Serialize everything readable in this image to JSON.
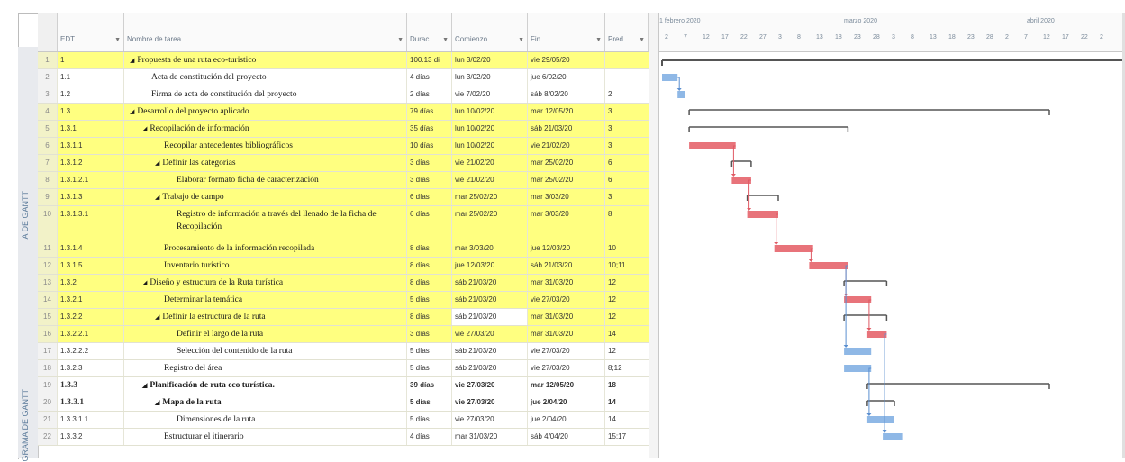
{
  "side_labels": [
    "A DE GANTT",
    "GRAMA DE GANTT"
  ],
  "columns": {
    "edt": "EDT",
    "name": "Nombre de tarea",
    "duration": "Durac",
    "start": "Comienzo",
    "end": "Fin",
    "pred": "Pred"
  },
  "timescale": {
    "months": [
      "1 febrero 2020",
      "marzo 2020",
      "abril 2020"
    ],
    "days": [
      "2",
      "7",
      "12",
      "17",
      "22",
      "27",
      "3",
      "8",
      "13",
      "18",
      "23",
      "28",
      "3",
      "8",
      "13",
      "18",
      "23",
      "28",
      "2",
      "7",
      "12",
      "17",
      "22",
      "2"
    ]
  },
  "rows": [
    {
      "num": "1",
      "edt": "1",
      "name": "Propuesta de una ruta eco-turistico",
      "indent": 0,
      "collapse": true,
      "yellow": true,
      "bold": false,
      "duration": "100.13 di",
      "start": "lun 3/02/20",
      "end": "vie 29/05/20",
      "pred": ""
    },
    {
      "num": "2",
      "edt": "1.1",
      "name": "Acta de constitución del proyecto",
      "indent": 1,
      "collapse": false,
      "yellow": false,
      "bold": false,
      "duration": "4 días",
      "start": "lun 3/02/20",
      "end": "jue 6/02/20",
      "pred": ""
    },
    {
      "num": "3",
      "edt": "1.2",
      "name": "Firma de acta de constitución del proyecto",
      "indent": 1,
      "collapse": false,
      "yellow": false,
      "bold": false,
      "duration": "2 días",
      "start": "vie 7/02/20",
      "end": "sáb 8/02/20",
      "pred": "2"
    },
    {
      "num": "4",
      "edt": "1.3",
      "name": "Desarrollo del proyecto aplicado",
      "indent": 0,
      "collapse": true,
      "yellow": true,
      "bold": false,
      "duration": "79 días",
      "start": "lun 10/02/20",
      "end": "mar 12/05/20",
      "pred": "3"
    },
    {
      "num": "5",
      "edt": "1.3.1",
      "name": "Recopilación de información",
      "indent": 1,
      "collapse": true,
      "yellow": true,
      "bold": false,
      "duration": "35 días",
      "start": "lun 10/02/20",
      "end": "sáb 21/03/20",
      "pred": "3"
    },
    {
      "num": "6",
      "edt": "1.3.1.1",
      "name": "Recopilar antecedentes bibliográficos",
      "indent": 2,
      "collapse": false,
      "yellow": true,
      "bold": false,
      "duration": "10 días",
      "start": "lun 10/02/20",
      "end": "vie 21/02/20",
      "pred": "3"
    },
    {
      "num": "7",
      "edt": "1.3.1.2",
      "name": "Definir las categorías",
      "indent": 2,
      "collapse": true,
      "yellow": true,
      "bold": false,
      "duration": "3 días",
      "start": "vie 21/02/20",
      "end": "mar 25/02/20",
      "pred": "6"
    },
    {
      "num": "8",
      "edt": "1.3.1.2.1",
      "name": "Elaborar formato ficha de caracterización",
      "indent": 3,
      "collapse": false,
      "yellow": true,
      "bold": false,
      "duration": "3 días",
      "start": "vie 21/02/20",
      "end": "mar 25/02/20",
      "pred": "6"
    },
    {
      "num": "9",
      "edt": "1.3.1.3",
      "name": "Trabajo de campo",
      "indent": 2,
      "collapse": true,
      "yellow": true,
      "bold": false,
      "duration": "6 días",
      "start": "mar 25/02/20",
      "end": "mar 3/03/20",
      "pred": "3"
    },
    {
      "num": "10",
      "edt": "1.3.1.3.1",
      "name": "Registro de información a través del llenado de la ficha de Recopilación",
      "indent": 3,
      "collapse": false,
      "yellow": true,
      "bold": false,
      "duration": "6 días",
      "start": "mar 25/02/20",
      "end": "mar 3/03/20",
      "pred": "8",
      "tall": true
    },
    {
      "num": "11",
      "edt": "1.3.1.4",
      "name": "Procesamiento de la información recopilada",
      "indent": 2,
      "collapse": false,
      "yellow": true,
      "bold": false,
      "duration": "8 días",
      "start": "mar 3/03/20",
      "end": "jue 12/03/20",
      "pred": "10"
    },
    {
      "num": "12",
      "edt": "1.3.1.5",
      "name": "Inventario turístico",
      "indent": 2,
      "collapse": false,
      "yellow": true,
      "bold": false,
      "duration": "8 días",
      "start": "jue 12/03/20",
      "end": "sáb 21/03/20",
      "pred": "10;11"
    },
    {
      "num": "13",
      "edt": "1.3.2",
      "name": "Diseño y estructura de la Ruta turística",
      "indent": 1,
      "collapse": true,
      "yellow": true,
      "bold": false,
      "duration": "8 días",
      "start": "sáb 21/03/20",
      "end": "mar 31/03/20",
      "pred": "12"
    },
    {
      "num": "14",
      "edt": "1.3.2.1",
      "name": "Determinar la temática",
      "indent": 2,
      "collapse": false,
      "yellow": true,
      "bold": false,
      "sans": true,
      "duration": "5 días",
      "start": "sáb 21/03/20",
      "end": "vie 27/03/20",
      "pred": "12"
    },
    {
      "num": "15",
      "edt": "1.3.2.2",
      "name": "Definir la estructura de la ruta",
      "indent": 2,
      "collapse": true,
      "yellow": true,
      "bold": false,
      "duration": "8 días",
      "start": "sáb 21/03/20",
      "end": "mar 31/03/20",
      "pred": "12",
      "sel": true
    },
    {
      "num": "16",
      "edt": "1.3.2.2.1",
      "name": "Definir el largo de la ruta",
      "indent": 3,
      "collapse": false,
      "yellow": true,
      "bold": false,
      "duration": "3 días",
      "start": "vie 27/03/20",
      "end": "mar 31/03/20",
      "pred": "14"
    },
    {
      "num": "17",
      "edt": "1.3.2.2.2",
      "name": "Selección del contenido de la ruta",
      "indent": 3,
      "collapse": false,
      "yellow": false,
      "bold": false,
      "duration": "5 días",
      "start": "sáb 21/03/20",
      "end": "vie 27/03/20",
      "pred": "12"
    },
    {
      "num": "18",
      "edt": "1.3.2.3",
      "name": "Registro del área",
      "indent": 2,
      "collapse": false,
      "yellow": false,
      "bold": false,
      "duration": "5 días",
      "start": "sáb 21/03/20",
      "end": "vie 27/03/20",
      "pred": "8;12"
    },
    {
      "num": "19",
      "edt": "1.3.3",
      "name": "Planificación de ruta eco turística.",
      "indent": 1,
      "collapse": true,
      "yellow": false,
      "bold": true,
      "duration": "39 días",
      "start": "vie 27/03/20",
      "end": "mar 12/05/20",
      "pred": "18"
    },
    {
      "num": "20",
      "edt": "1.3.3.1",
      "name": "Mapa de la ruta",
      "indent": 2,
      "collapse": true,
      "yellow": false,
      "bold": true,
      "duration": "5 días",
      "start": "vie 27/03/20",
      "end": "jue 2/04/20",
      "pred": "14"
    },
    {
      "num": "21",
      "edt": "1.3.3.1.1",
      "name": "Dimensiones de la ruta",
      "indent": 3,
      "collapse": false,
      "yellow": false,
      "bold": false,
      "duration": "5 días",
      "start": "vie 27/03/20",
      "end": "jue 2/04/20",
      "pred": "14"
    },
    {
      "num": "22",
      "edt": "1.3.3.2",
      "name": "Estructurar el itinerario",
      "indent": 2,
      "collapse": false,
      "yellow": false,
      "bold": false,
      "duration": "4 días",
      "start": "mar 31/03/20",
      "end": "sáb 4/04/20",
      "pred": "15;17"
    }
  ],
  "colors": {
    "critical_bar": "#e8737a",
    "normal_bar": "#8fb8e6",
    "summary_bar": "#555555",
    "highlight": "#ffff80"
  }
}
